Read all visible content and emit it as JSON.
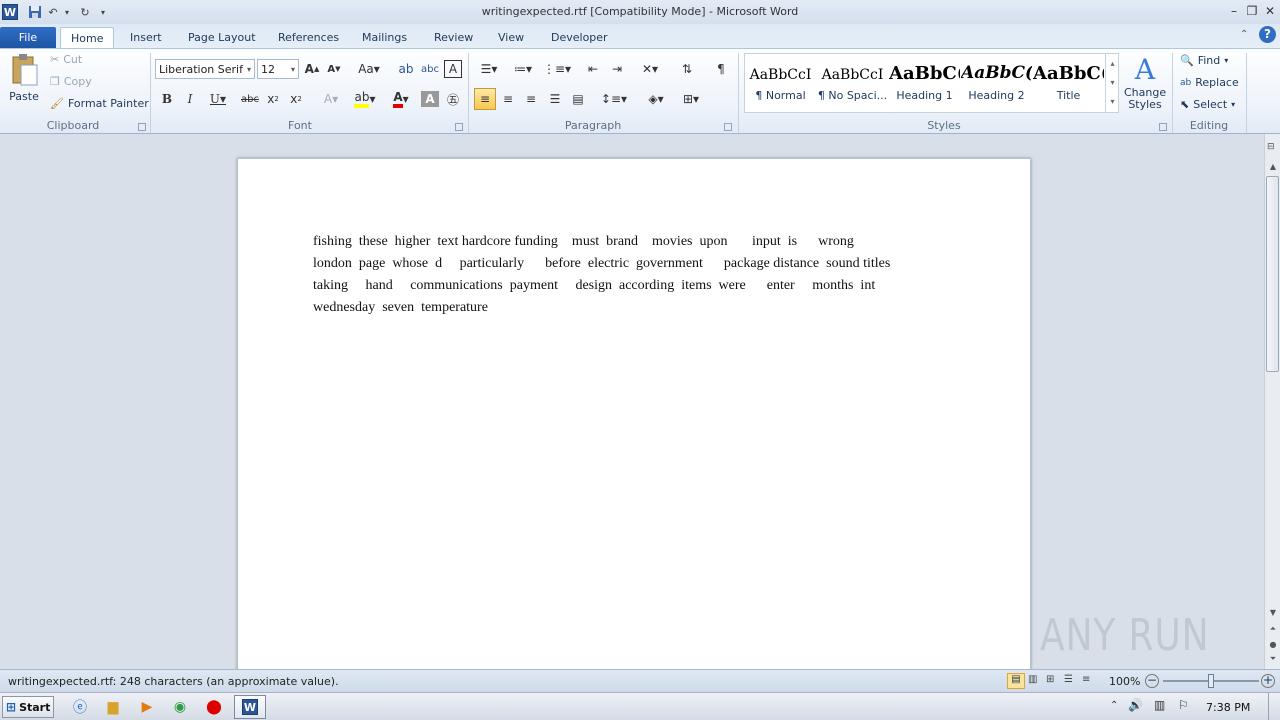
{
  "window": {
    "title": "writingexpected.rtf [Compatibility Mode]  -  Microsoft Word"
  },
  "tabs": [
    "File",
    "Home",
    "Insert",
    "Page Layout",
    "References",
    "Mailings",
    "Review",
    "View",
    "Developer"
  ],
  "clipboard": {
    "paste": "Paste",
    "cut": "Cut",
    "copy": "Copy",
    "format_painter": "Format Painter",
    "label": "Clipboard"
  },
  "font": {
    "name": "Liberation Serif",
    "size": "12",
    "label": "Font"
  },
  "paragraph": {
    "label": "Paragraph"
  },
  "styles": {
    "items": [
      {
        "preview": "AaBbCcI",
        "name": "¶ Normal"
      },
      {
        "preview": "AaBbCcI",
        "name": "¶ No Spaci..."
      },
      {
        "preview": "AaBbC(",
        "name": "Heading 1"
      },
      {
        "preview": "AaBbC(",
        "name": "Heading 2"
      },
      {
        "preview": "AaBbC(",
        "name": "Title"
      }
    ],
    "change_styles": "Change Styles",
    "label": "Styles"
  },
  "editing": {
    "find": "Find",
    "replace": "Replace",
    "select": "Select",
    "label": "Editing"
  },
  "document": {
    "lines": [
      "fishing  these  higher  text hardcore funding    must  brand    movies  upon       input  is      wrong",
      "london  page  whose  d     particularly      before  electric  government      package distance  sound titles",
      "taking     hand     communications  payment     design  according  items  were      enter     months  int",
      "wednesday  seven  temperature"
    ]
  },
  "status": {
    "text": "writingexpected.rtf: 248 characters (an approximate value).",
    "zoom": "100%",
    "zoom_level": 0.5
  },
  "taskbar": {
    "start": "Start",
    "time": "7:38 PM"
  },
  "watermark": "ANY RUN"
}
